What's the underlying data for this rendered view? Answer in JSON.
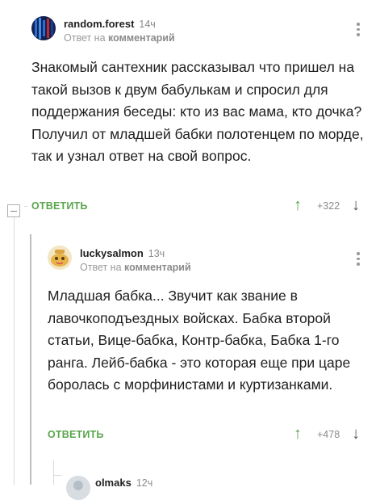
{
  "comments": [
    {
      "username": "random.forest",
      "time": "14ч",
      "reply_prefix": "Ответ на",
      "reply_target": "комментарий",
      "text": "Знакомый сантехник рассказывал что пришел на такой вызов к двум бабулькам и спросил для поддержания беседы: кто из вас мама, кто дочка? Получил от младшей бабки полотенцем по морде, так и узнал ответ на свой вопрос.",
      "reply_label": "ОТВЕТИТЬ",
      "score": "+322",
      "avatar_icon": "user-avatar-icon",
      "avatar_colors": [
        "#1f3b8a",
        "#2a6cd1",
        "#c2292e"
      ]
    },
    {
      "username": "luckysalmon",
      "time": "13ч",
      "reply_prefix": "Ответ на",
      "reply_target": "комментарий",
      "text": "Младшая бабка... Звучит как звание в лавочкоподъездных войсках. Бабка второй статьи, Вице-бабка, Контр-бабка, Бабка 1-го ранга. Лейб-бабка - это которая еще при царе боролась с морфинистами и куртизанками.",
      "reply_label": "ОТВЕТИТЬ",
      "score": "+478",
      "avatar_icon": "user-avatar-icon",
      "avatar_colors": [
        "#f1dfb4",
        "#e0a93a",
        "#d9534f"
      ]
    },
    {
      "username": "olmaks",
      "time": "12ч",
      "avatar_icon": "user-avatar-icon",
      "avatar_colors": [
        "#cfd6dc"
      ]
    }
  ],
  "icons": {
    "upvote": "↑",
    "downvote": "↓",
    "more": "more-vertical-icon",
    "collapse": "collapse-minus-icon"
  }
}
